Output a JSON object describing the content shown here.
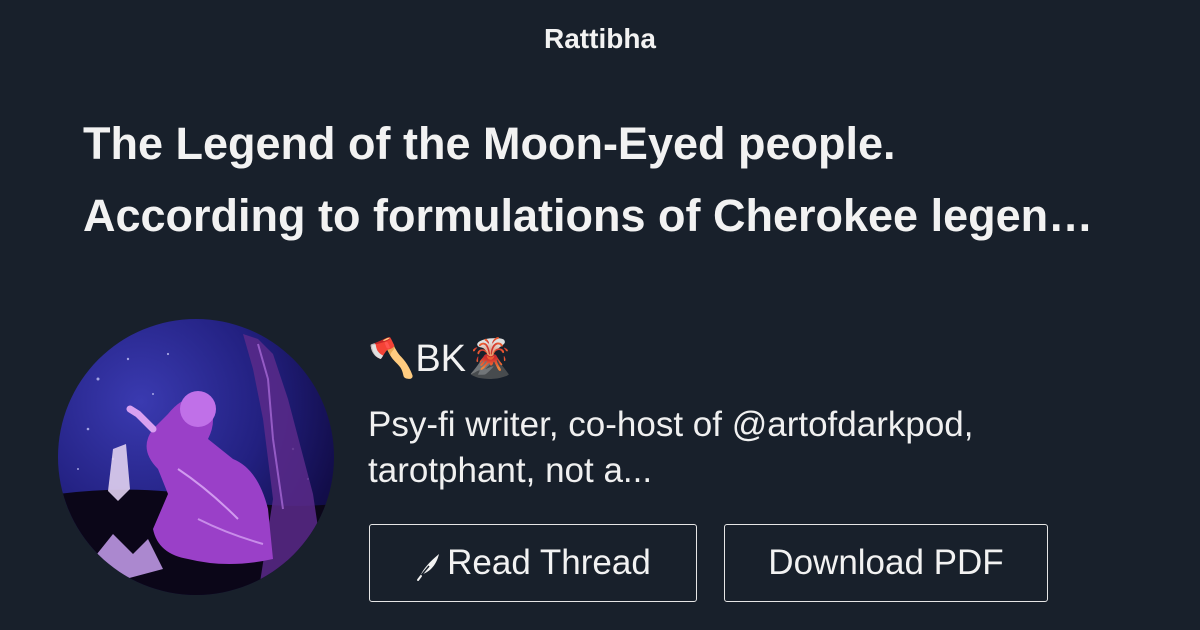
{
  "site": {
    "name": "Rattibha"
  },
  "thread": {
    "title_line1": "The Legend of the Moon-Eyed people.",
    "title_line2": "According to formulations of Cherokee legen…"
  },
  "author": {
    "avatar_icon": "avatar-image",
    "name": "🪓BK🌋",
    "bio": "Psy-fi writer, co-host of @artofdarkpod, tarotphant, not a..."
  },
  "actions": {
    "read_thread_label": "Read Thread",
    "read_thread_icon": "feather-icon",
    "download_pdf_label": "Download PDF"
  },
  "colors": {
    "background": "#18202b",
    "text": "#f2f2f2",
    "button_border": "#e6e6e6"
  }
}
